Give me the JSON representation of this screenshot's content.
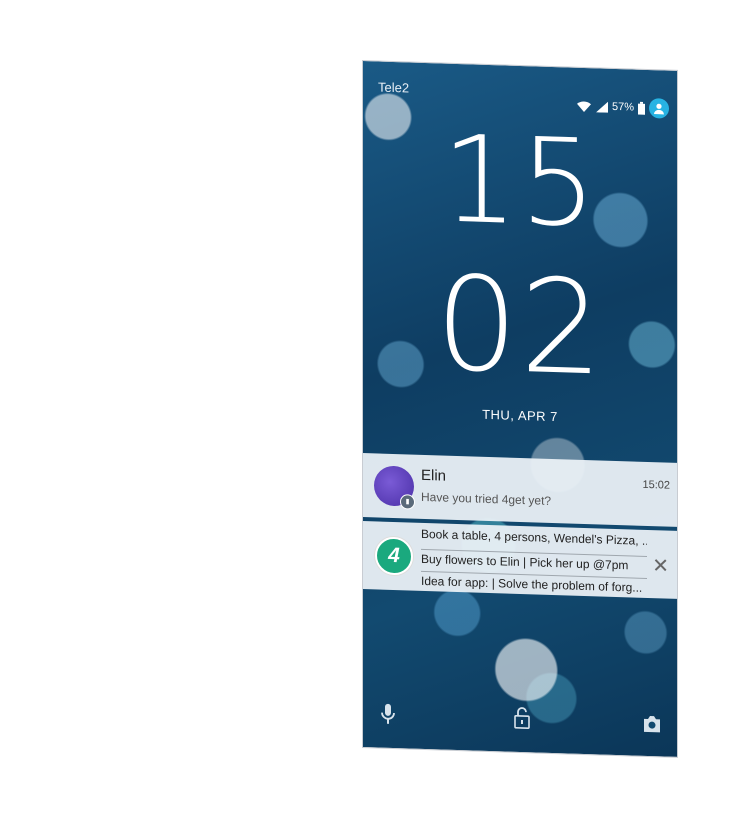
{
  "status_bar": {
    "carrier": "Tele2",
    "battery": "57%"
  },
  "clock": {
    "hour": "15",
    "minute": "02",
    "date": "THU, APR 7"
  },
  "notification_message": {
    "sender": "Elin",
    "text": "Have you tried 4get yet?",
    "time": "15:02"
  },
  "notification_tasks": {
    "app_icon_label": "4",
    "items": [
      "Book a table, 4 persons, Wendel's Pizza, ...",
      "Buy flowers to Elin | Pick her up @7pm",
      "Idea for app: | Solve the problem of forg..."
    ]
  },
  "bottom_bar": {
    "icons": [
      "microphone-icon",
      "unlock-icon",
      "camera-icon"
    ]
  }
}
